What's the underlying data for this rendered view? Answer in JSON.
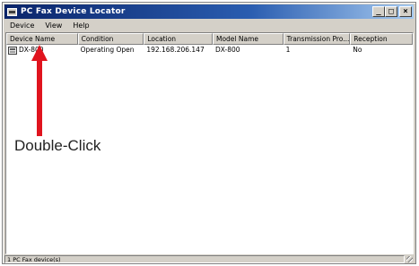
{
  "window": {
    "title": "PC Fax Device Locator",
    "minimize_glyph": "_",
    "maximize_glyph": "□",
    "close_glyph": "×"
  },
  "menu": {
    "items": [
      {
        "label": "Device"
      },
      {
        "label": "View"
      },
      {
        "label": "Help"
      }
    ]
  },
  "list": {
    "columns": [
      {
        "label": "Device Name"
      },
      {
        "label": "Condition"
      },
      {
        "label": "Location"
      },
      {
        "label": "Model Name"
      },
      {
        "label": "Transmission Pro..."
      },
      {
        "label": "Reception"
      }
    ],
    "rows": [
      {
        "icon": "fax-device-icon",
        "cells": [
          "DX-800",
          "Operating Open",
          "192.168.206.147",
          "DX-800",
          "1",
          "No"
        ]
      }
    ]
  },
  "annotation": {
    "text": "Double-Click",
    "arrow_color": "#e0141e"
  },
  "status": {
    "text": "1 PC Fax device(s)"
  },
  "colors": {
    "titlebar_start": "#0a246a",
    "titlebar_end": "#a6caf0",
    "face": "#d4d0c8",
    "accent_arrow": "#e0141e"
  }
}
